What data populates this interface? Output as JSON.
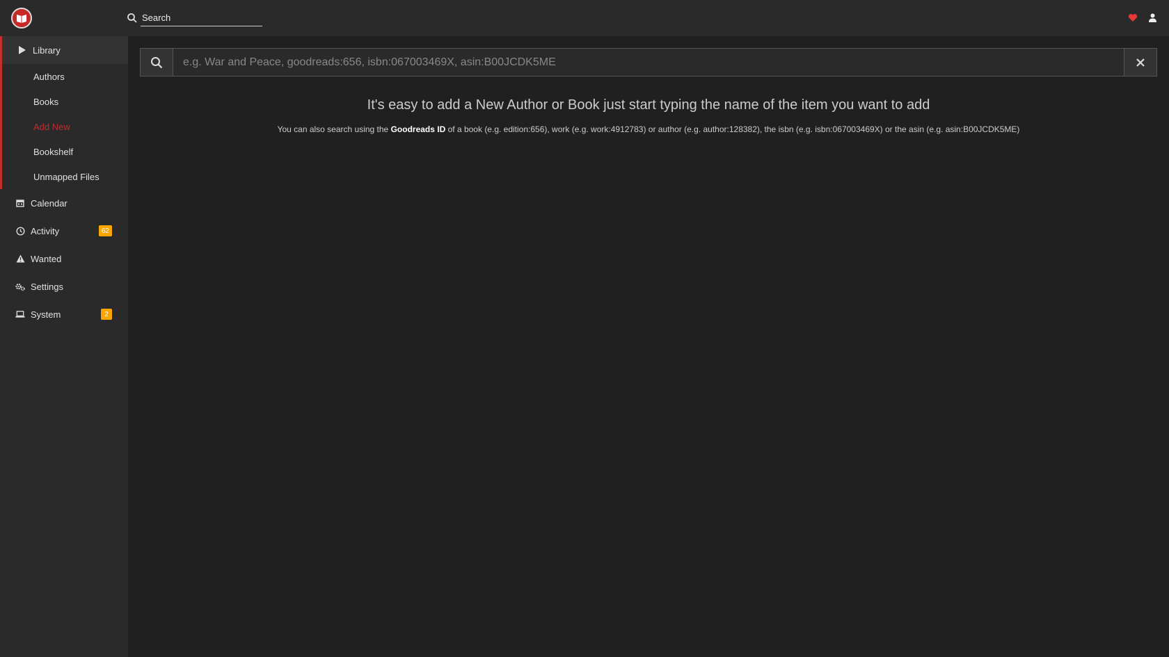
{
  "header": {
    "search_placeholder": "Search"
  },
  "sidebar": {
    "library": {
      "label": "Library",
      "items": [
        {
          "label": "Authors"
        },
        {
          "label": "Books"
        },
        {
          "label": "Add New"
        },
        {
          "label": "Bookshelf"
        },
        {
          "label": "Unmapped Files"
        }
      ]
    },
    "items": [
      {
        "label": "Calendar",
        "icon": "calendar-icon"
      },
      {
        "label": "Activity",
        "icon": "clock-icon",
        "badge": "62"
      },
      {
        "label": "Wanted",
        "icon": "warning-icon"
      },
      {
        "label": "Settings",
        "icon": "gears-icon"
      },
      {
        "label": "System",
        "icon": "laptop-icon",
        "badge": "2"
      }
    ]
  },
  "main": {
    "search_placeholder": "e.g. War and Peace, goodreads:656, isbn:067003469X, asin:B00JCDK5ME",
    "help_title": "It's easy to add a New Author or Book just start typing the name of the item you want to add",
    "help_prefix": "You can also search using the",
    "help_bold": "Goodreads ID",
    "help_suffix": "of a book (e.g. edition:656), work (e.g. work:4912783) or author (e.g. author:128382), the isbn (e.g. isbn:067003469X) or the asin (e.g. asin:B00JCDK5ME)"
  },
  "colors": {
    "accent": "#c12f2f",
    "badge": "#ffa500",
    "background": "#202020",
    "panel": "#2a2a2a"
  }
}
